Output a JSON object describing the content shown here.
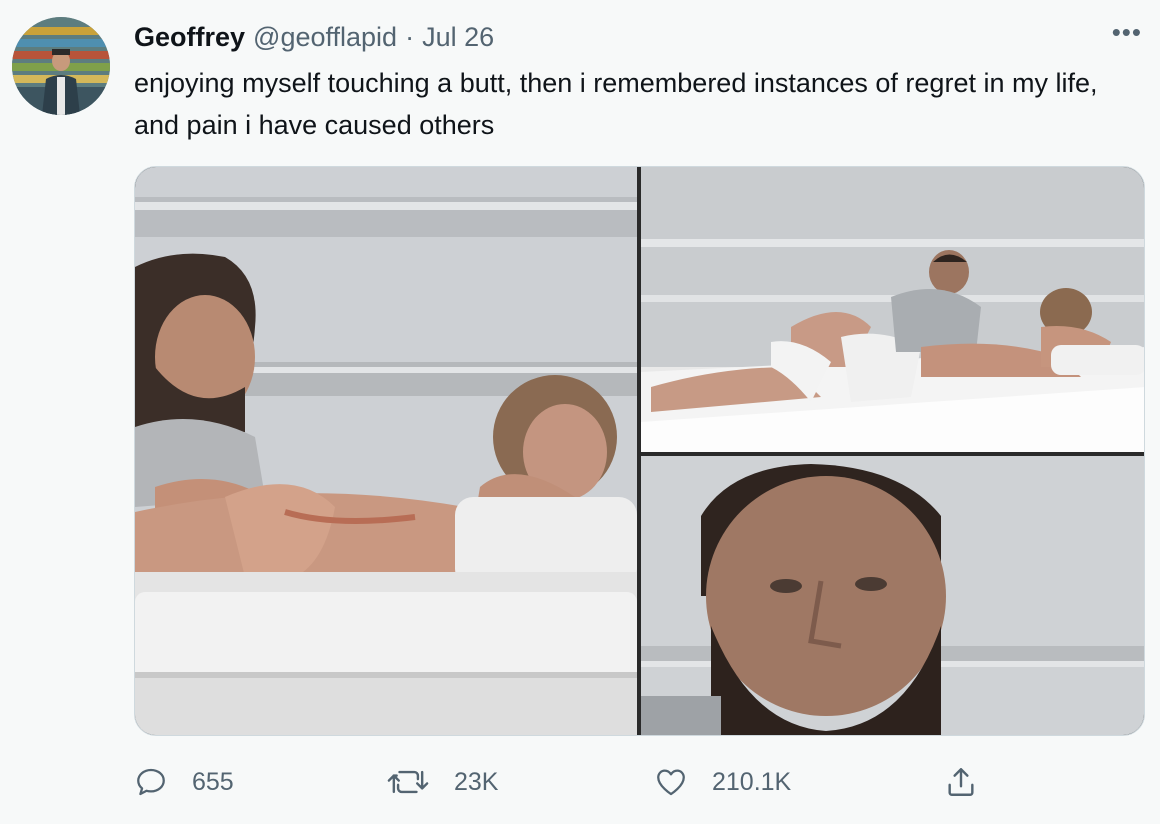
{
  "author": {
    "display_name": "Geoffrey",
    "handle": "@geofflapid",
    "separator": "·",
    "date": "Jul 26"
  },
  "tweet": {
    "text": "enjoying myself touching a butt, then i remembered instances of regret in my life, and pain i have caused others"
  },
  "media": [
    {
      "icon": "photo-couple-on-yacht-closeup"
    },
    {
      "icon": "photo-couple-on-yacht-wide"
    },
    {
      "icon": "photo-man-face-closeup"
    }
  ],
  "actions": {
    "replies": "655",
    "retweets": "23K",
    "likes": "210.1K"
  },
  "icons": {
    "more": "more-dots-icon",
    "reply": "reply-icon",
    "retweet": "retweet-icon",
    "like": "heart-icon",
    "share": "share-icon"
  },
  "colors": {
    "background": "#f7f9f9",
    "text_primary": "#0f1419",
    "text_secondary": "#536471"
  }
}
